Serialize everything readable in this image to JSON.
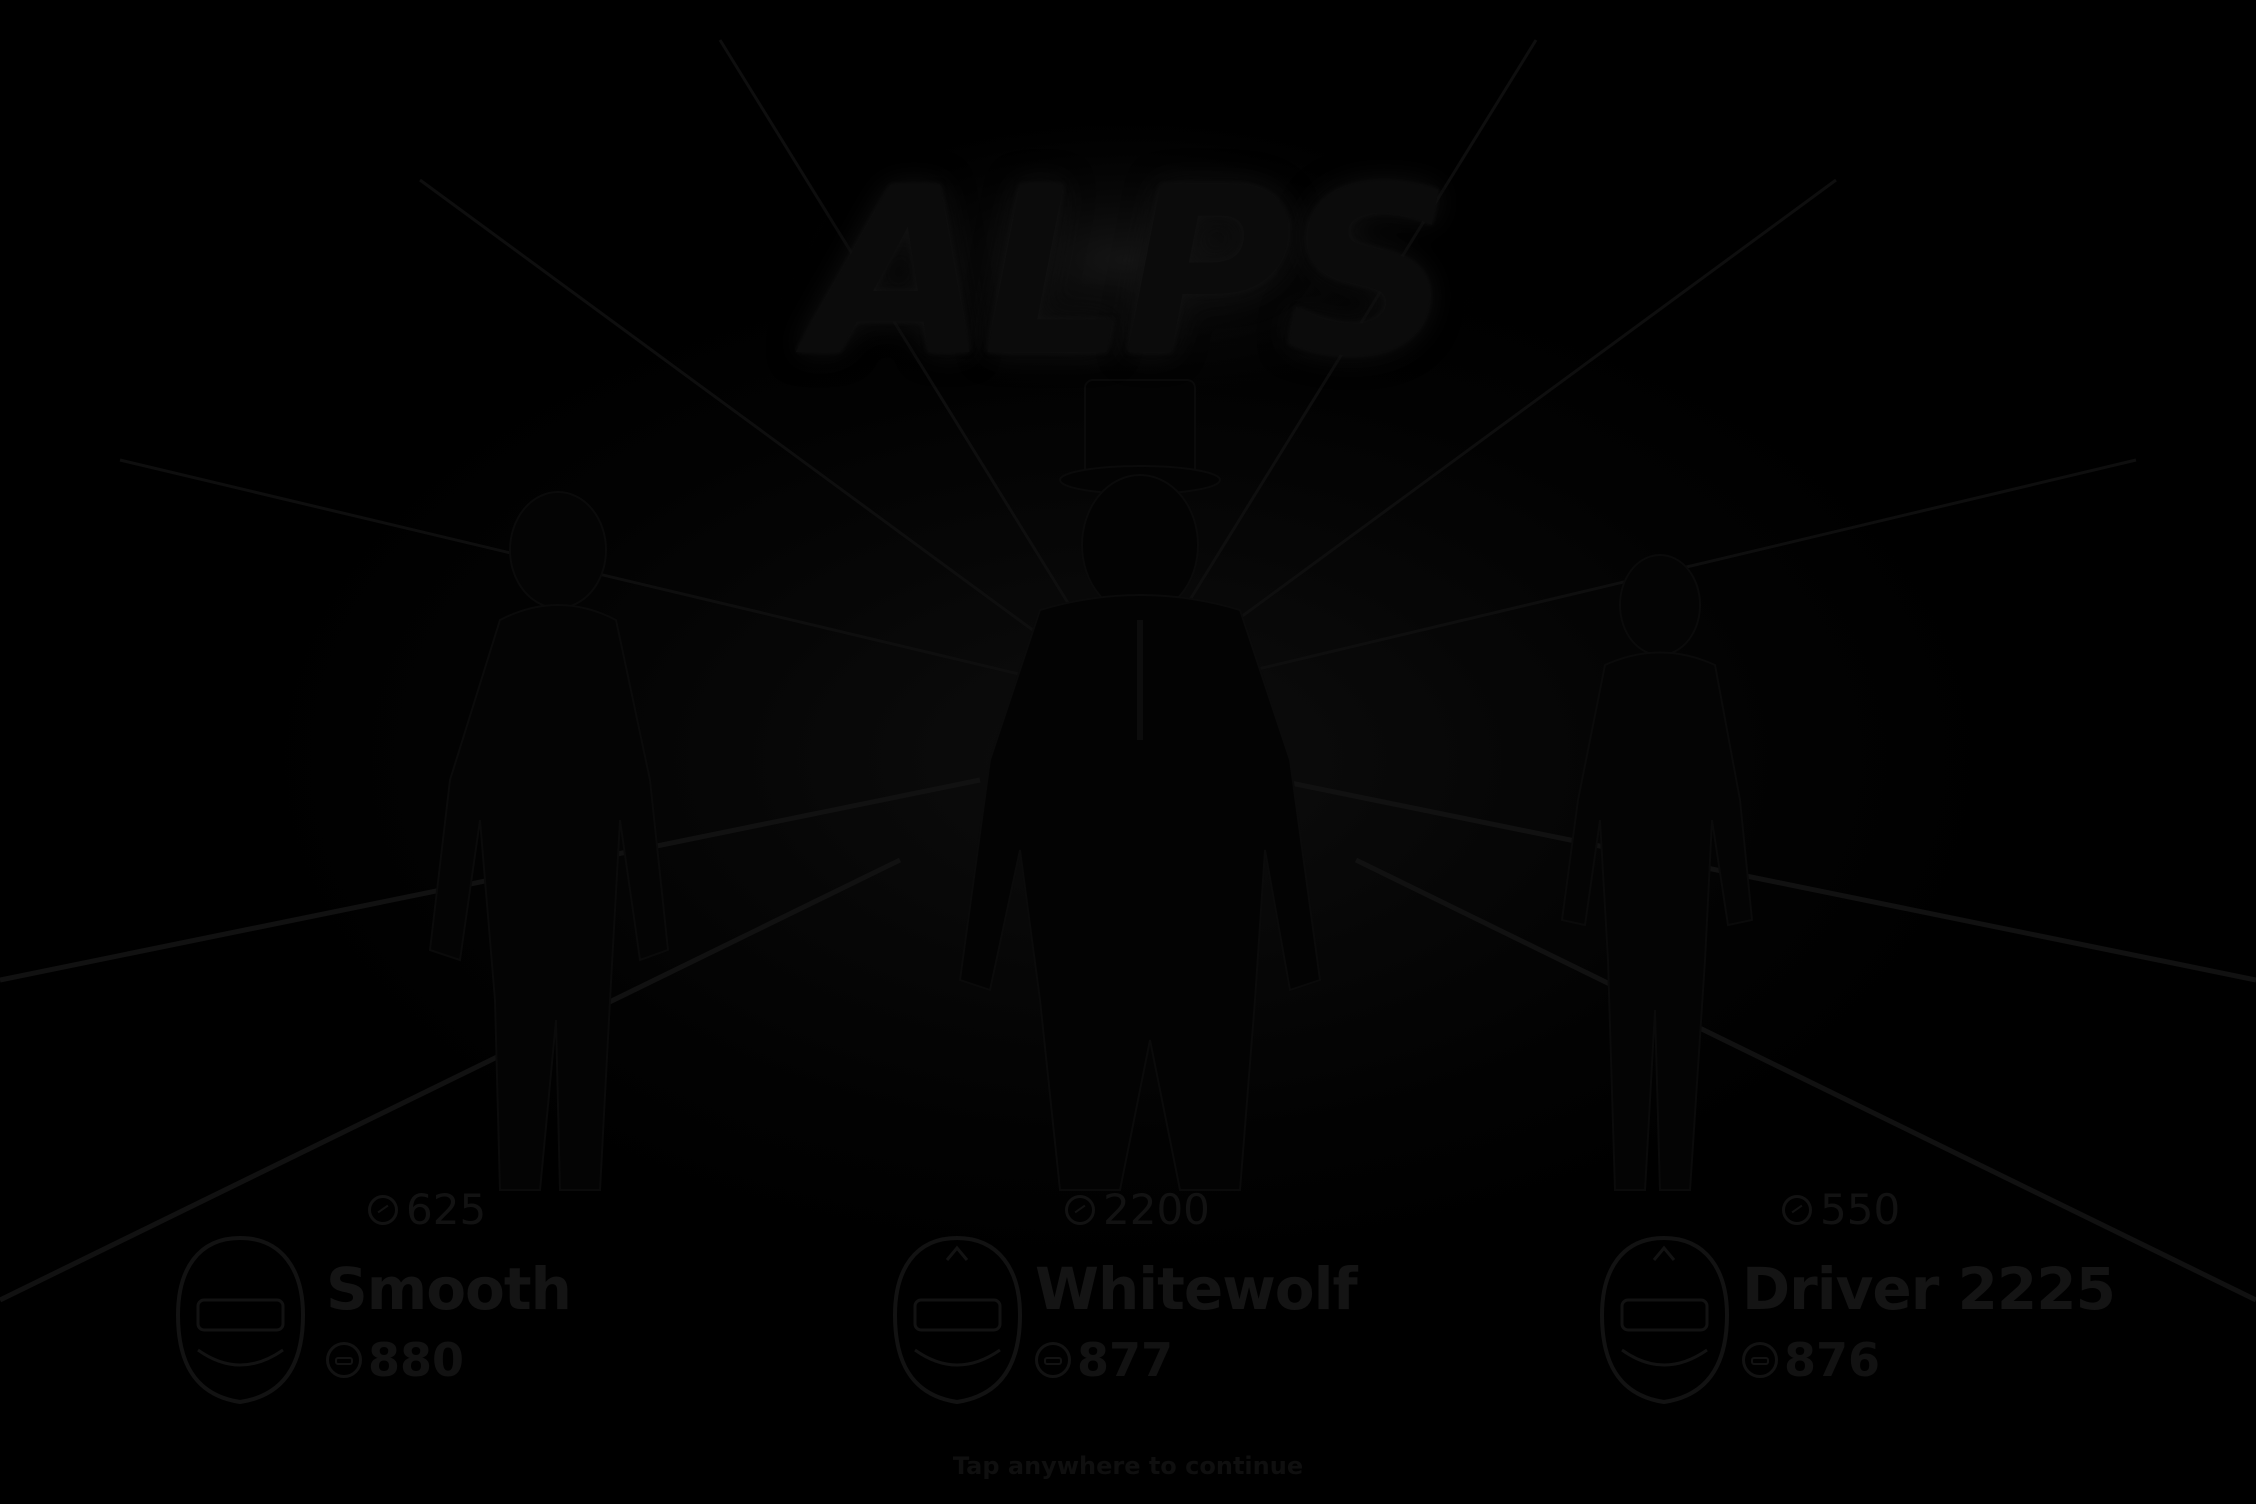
{
  "game": {
    "title": "ALPS",
    "hint": "Tap anywhere to continue"
  },
  "drivers": [
    {
      "rating": "625",
      "name": "Smooth",
      "score": "880"
    },
    {
      "rating": "2200",
      "name": "Whitewolf",
      "score": "877"
    },
    {
      "rating": "550",
      "name": "Driver 2225",
      "score": "876"
    }
  ],
  "colors": {
    "background": "#000000",
    "dim_text": "#141414",
    "silhouette": "#050505"
  }
}
